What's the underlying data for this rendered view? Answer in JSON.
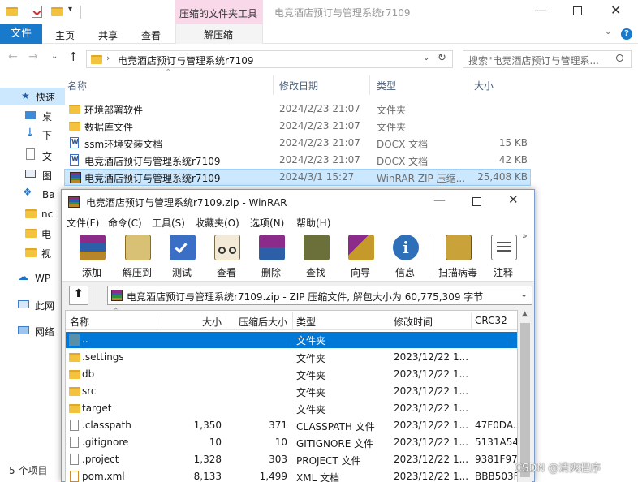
{
  "explorer": {
    "title": "电竞酒店预订与管理系统r7109",
    "ribbon_tools_group": "压缩的文件夹工具",
    "tabs": [
      "文件",
      "主页",
      "共享",
      "查看",
      "解压缩"
    ],
    "address": "电竞酒店预订与管理系统r7109",
    "search_placeholder": "搜索\"电竞酒店预订与管理系...",
    "nav": [
      "快速",
      "桌",
      "下",
      "文",
      "图",
      "Ba",
      "nc",
      "电",
      "视",
      "WP",
      "此网",
      "网络"
    ],
    "columns": [
      "名称",
      "修改日期",
      "类型",
      "大小"
    ],
    "files": [
      {
        "name": "环境部署软件",
        "date": "2024/2/23 21:07",
        "type": "文件夹",
        "size": "",
        "icon": "folder-icon"
      },
      {
        "name": "数据库文件",
        "date": "2024/2/23 21:07",
        "type": "文件夹",
        "size": "",
        "icon": "folder-icon"
      },
      {
        "name": "ssm环境安装文档",
        "date": "2024/2/23 21:07",
        "type": "DOCX 文档",
        "size": "15 KB",
        "icon": "word-doc-icon"
      },
      {
        "name": "电竞酒店预订与管理系统r7109",
        "date": "2024/2/23 21:07",
        "type": "DOCX 文档",
        "size": "42 KB",
        "icon": "word-doc-icon"
      },
      {
        "name": "电竞酒店预订与管理系统r7109",
        "date": "2024/3/1 15:27",
        "type": "WinRAR ZIP 压缩...",
        "size": "25,408 KB",
        "icon": "winrar-zip-icon"
      }
    ],
    "status_items": "5 个项目"
  },
  "winrar": {
    "title": "电竞酒店预订与管理系统r7109.zip - WinRAR",
    "menu": [
      "文件(F)",
      "命令(C)",
      "工具(S)",
      "收藏夹(O)",
      "选项(N)",
      "帮助(H)"
    ],
    "toolbar": [
      "添加",
      "解压到",
      "测试",
      "查看",
      "删除",
      "查找",
      "向导",
      "信息",
      "扫描病毒",
      "注释"
    ],
    "path": "电竞酒店预订与管理系统r7109.zip - ZIP 压缩文件, 解包大小为 60,775,309 字节",
    "columns": [
      "名称",
      "大小",
      "压缩后大小",
      "类型",
      "修改时间",
      "CRC32"
    ],
    "rows": [
      {
        "name": "..",
        "size": "",
        "packed": "",
        "type": "文件夹",
        "modified": "",
        "crc": "",
        "icon": "parent-folder-icon"
      },
      {
        "name": ".settings",
        "size": "",
        "packed": "",
        "type": "文件夹",
        "modified": "2023/12/22 1...",
        "crc": "",
        "icon": "folder-icon"
      },
      {
        "name": "db",
        "size": "",
        "packed": "",
        "type": "文件夹",
        "modified": "2023/12/22 1...",
        "crc": "",
        "icon": "folder-icon"
      },
      {
        "name": "src",
        "size": "",
        "packed": "",
        "type": "文件夹",
        "modified": "2023/12/22 1...",
        "crc": "",
        "icon": "folder-icon"
      },
      {
        "name": "target",
        "size": "",
        "packed": "",
        "type": "文件夹",
        "modified": "2023/12/22 1...",
        "crc": "",
        "icon": "folder-icon"
      },
      {
        "name": ".classpath",
        "size": "1,350",
        "packed": "371",
        "type": "CLASSPATH 文件",
        "modified": "2023/12/22 1...",
        "crc": "47F0DA...",
        "icon": "file-icon"
      },
      {
        "name": ".gitignore",
        "size": "10",
        "packed": "10",
        "type": "GITIGNORE 文件",
        "modified": "2023/12/22 1...",
        "crc": "5131A54E",
        "icon": "file-icon"
      },
      {
        "name": ".project",
        "size": "1,328",
        "packed": "303",
        "type": "PROJECT 文件",
        "modified": "2023/12/22 1...",
        "crc": "9381F978",
        "icon": "file-icon"
      },
      {
        "name": "pom.xml",
        "size": "8,133",
        "packed": "1,499",
        "type": "XML 文档",
        "modified": "2023/12/22 1...",
        "crc": "BBB503F",
        "icon": "xml-file-icon"
      }
    ]
  },
  "watermark": "CSDN @清爽程序"
}
